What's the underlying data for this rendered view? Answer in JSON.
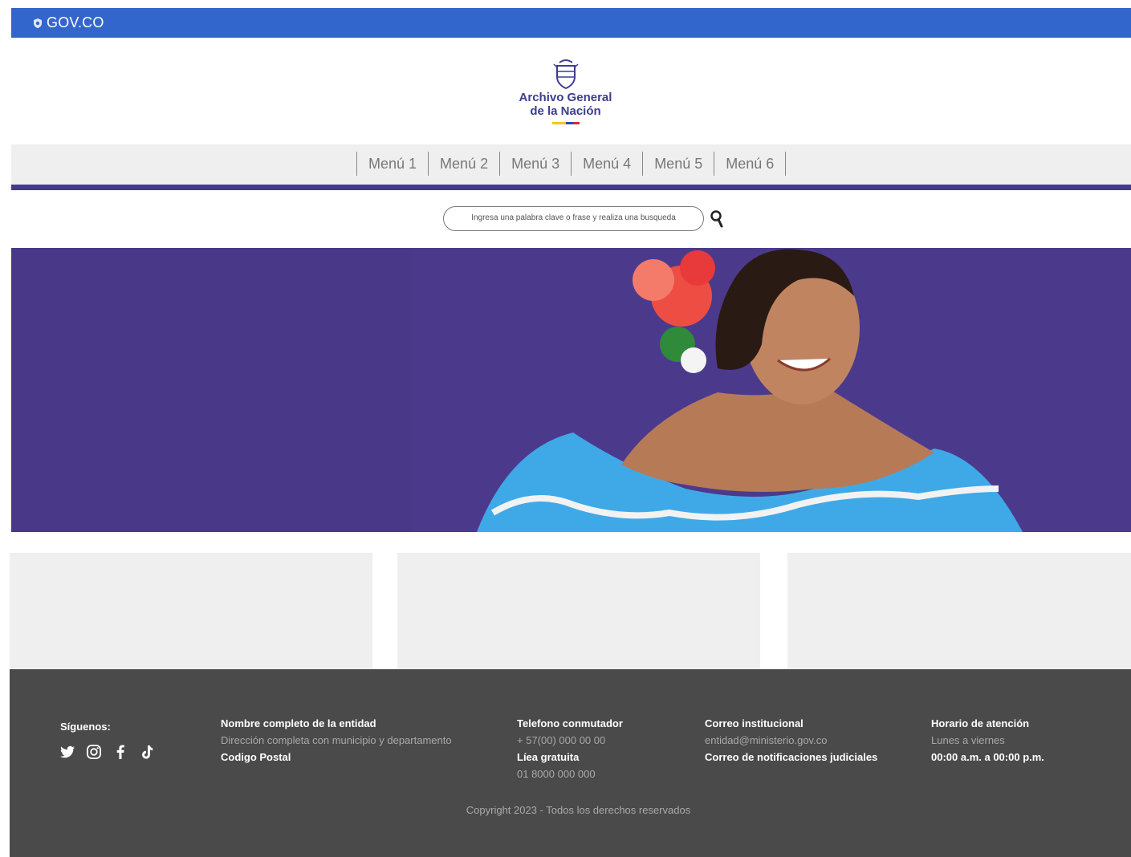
{
  "govbar": {
    "brand": "GOV.CO"
  },
  "logo": {
    "line1": "Archivo General",
    "line2": "de la Nación"
  },
  "menu": {
    "items": [
      "Menú 1",
      "Menú 2",
      "Menú 3",
      "Menú 4",
      "Menú 5",
      "Menú 6"
    ]
  },
  "search": {
    "placeholder": "Ingresa una palabra clave o frase y realiza una busqueda"
  },
  "footer": {
    "follow_label": "Síguenos:",
    "entity_name": "Nombre completo de la entidad",
    "entity_address": "Dirección completa con municipio y departamento",
    "postal_code": "Codigo Postal",
    "phone_title": "Telefono conmutador",
    "phone_value": "+ 57(00) 000 00 00",
    "tollfree_title": "Líea gratuita",
    "tollfree_value": "01 8000 000 000",
    "email_title": "Correo institucional",
    "email_value": "entidad@ministerio.gov.co",
    "judicial_email_title": "Correo de notificaciones judiciales",
    "hours_title": "Horario de atención",
    "hours_days": "Lunes a viernes",
    "hours_time": "00:00 a.m. a 00:00 p.m.",
    "copyright": "Copyright 2023 - Todos los derechos reservados"
  },
  "colors": {
    "govbar": "#3366cc",
    "menu_underline": "#433b8f",
    "hero_background": "#4b3a8c",
    "footer": "#4a4a4a",
    "logo_text": "#3d3d8f"
  },
  "icons": {
    "gov": "shield-icon",
    "emblem": "coat-of-arms-icon",
    "search": "search-icon",
    "social": [
      "twitter-icon",
      "instagram-icon",
      "facebook-icon",
      "tiktok-icon"
    ]
  }
}
